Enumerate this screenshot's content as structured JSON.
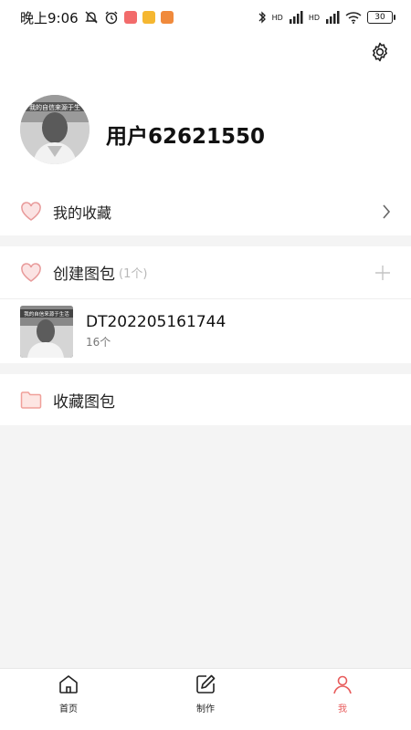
{
  "status_bar": {
    "time": "晚上9:06",
    "network_1": "HD",
    "network_2": "HD",
    "battery": "30"
  },
  "profile": {
    "username": "用户62621550",
    "settings_icon": "gear-icon",
    "avatar_caption": "我的自信来源于生"
  },
  "favorites": {
    "label": "我的收藏",
    "icon": "heart-icon"
  },
  "create_pack": {
    "label": "创建图包",
    "count": "(1个)",
    "icon": "heart-icon",
    "add_icon": "plus-icon"
  },
  "packs": [
    {
      "name": "DT202205161744",
      "count": "16个",
      "thumb_caption": "我的自信来源于生活"
    }
  ],
  "favorite_packs": {
    "label": "收藏图包",
    "icon": "folder-icon"
  },
  "bottom_nav": {
    "items": [
      {
        "label": "首页",
        "icon": "home-icon"
      },
      {
        "label": "制作",
        "icon": "edit-icon"
      },
      {
        "label": "我",
        "icon": "user-icon"
      }
    ],
    "active_color": "#e85c5c"
  },
  "colors": {
    "accent": "#e85c5c",
    "heart_fill": "#fbe3e3",
    "heart_stroke": "#e89a9a",
    "folder": "#f5a6a0"
  }
}
